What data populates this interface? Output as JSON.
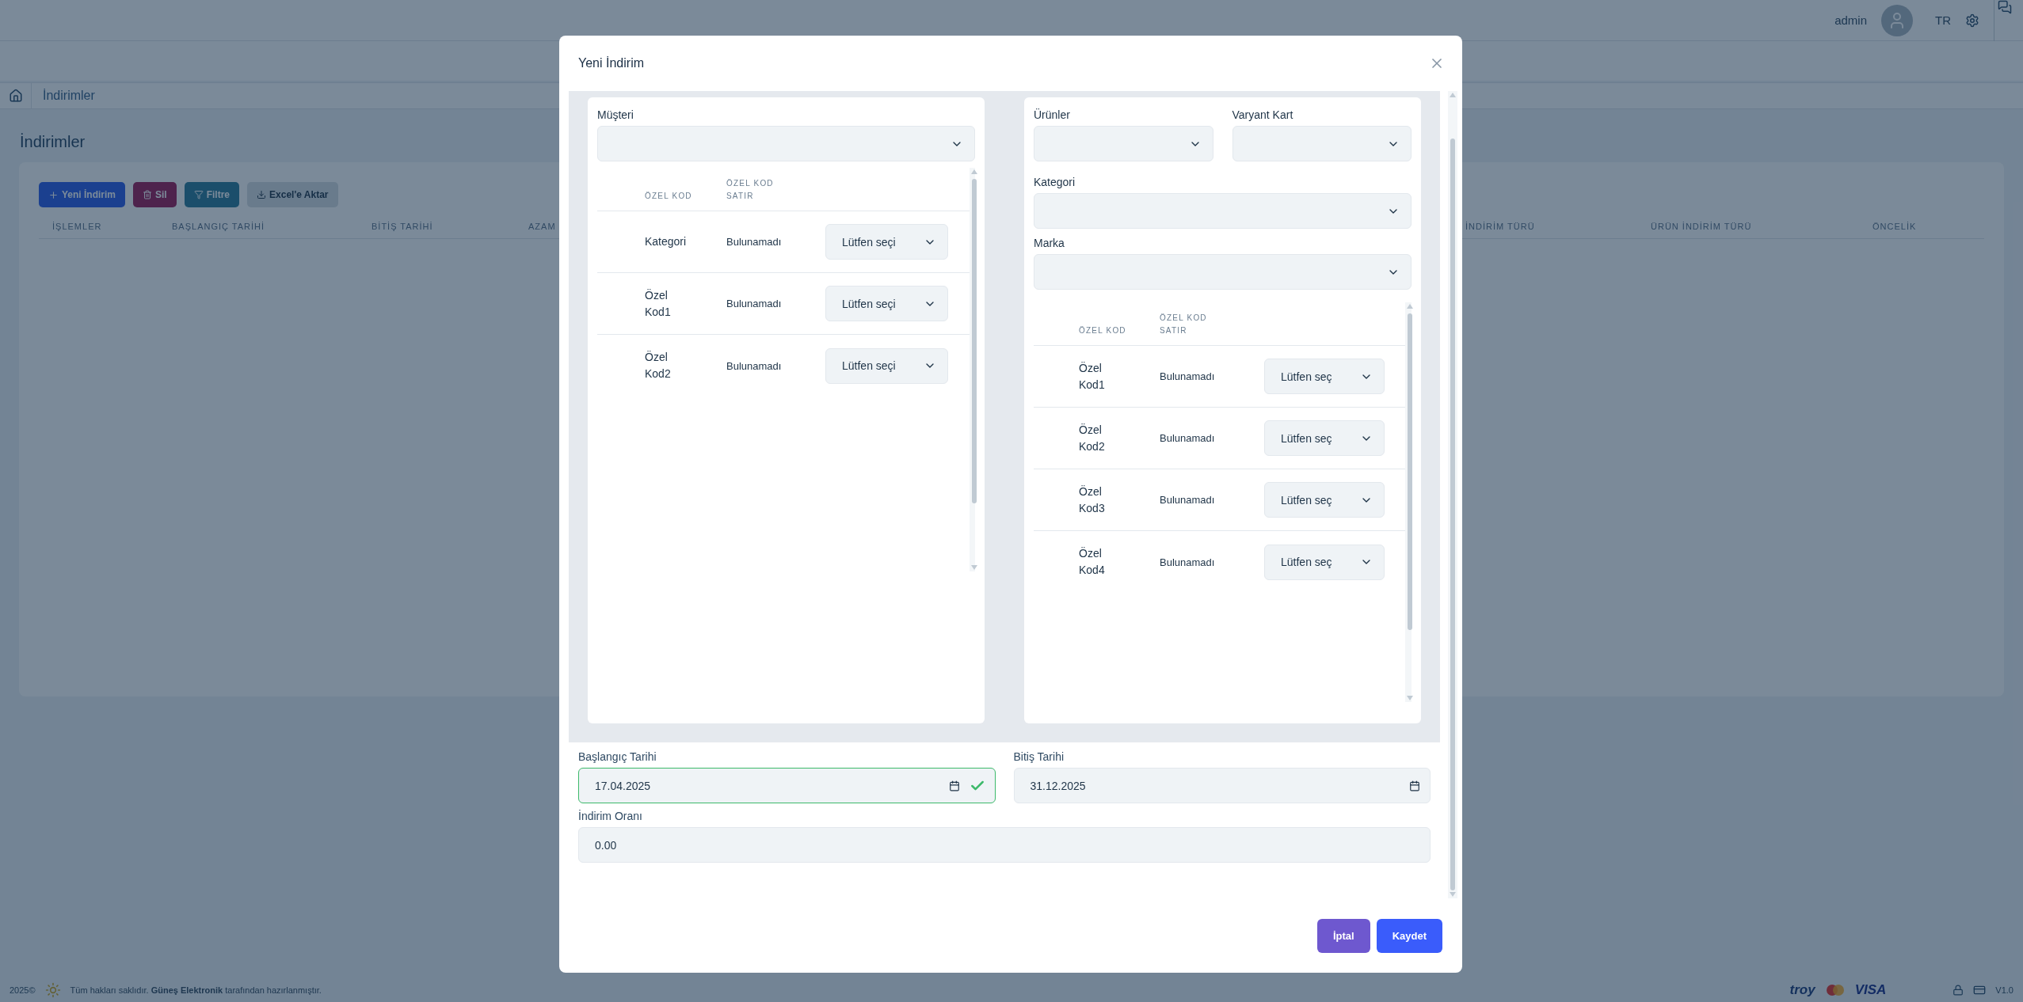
{
  "topbar": {
    "user": "admin",
    "language": "TR"
  },
  "breadcrumb": {
    "current": "İndirimler"
  },
  "page": {
    "title": "İndirimler",
    "buttons": [
      {
        "label": "Yeni İndirim",
        "kind": "add"
      },
      {
        "label": "Sil",
        "kind": "delete"
      },
      {
        "label": "Filtre",
        "kind": "filter"
      },
      {
        "label": "Excel'e Aktar",
        "kind": "export"
      }
    ],
    "columns": [
      "İŞLEMLER",
      "BAŞLANGIÇ TARİHİ",
      "BİTİŞ TARİHİ",
      "AZAM",
      "İNDİRİM TÜRÜ",
      "ÜRÜN İNDİRİM TÜRÜ",
      "ÖNCELİK"
    ]
  },
  "modal": {
    "title": "Yeni İndirim",
    "customer_panel": {
      "label": "Müşteri",
      "table": {
        "columns": [
          "ÖZEL KOD",
          "ÖZEL KOD SATIR"
        ],
        "rows": [
          {
            "code": "Kategori",
            "line": "Bulunamadı",
            "select": "Lütfen seçi"
          },
          {
            "code": "Özel Kod1",
            "line": "Bulunamadı",
            "select": "Lütfen seçi"
          },
          {
            "code": "Özel Kod2",
            "line": "Bulunamadı",
            "select": "Lütfen seçi"
          }
        ]
      }
    },
    "product_panel": {
      "fields": [
        {
          "label": "Ürünler"
        },
        {
          "label": "Varyant Kart"
        },
        {
          "label": "Kategori"
        },
        {
          "label": "Marka"
        }
      ],
      "table": {
        "columns": [
          "ÖZEL KOD",
          "ÖZEL KOD SATIR"
        ],
        "rows": [
          {
            "code": "Özel Kod1",
            "line": "Bulunamadı",
            "select": "Lütfen seç"
          },
          {
            "code": "Özel Kod2",
            "line": "Bulunamadı",
            "select": "Lütfen seç"
          },
          {
            "code": "Özel Kod3",
            "line": "Bulunamadı",
            "select": "Lütfen seç"
          },
          {
            "code": "Özel Kod4",
            "line": "Bulunamadı",
            "select": "Lütfen seç"
          }
        ]
      }
    },
    "dates": [
      {
        "label": "Başlangıç Tarihi",
        "value": "17.04.2025",
        "valid": true
      },
      {
        "label": "Bitiş Tarihi",
        "value": "31.12.2025",
        "valid": false
      }
    ],
    "rate": {
      "label": "İndirim Oranı",
      "value": "0.00"
    },
    "buttons": [
      {
        "label": "İptal",
        "kind": "cancel"
      },
      {
        "label": "Kaydet",
        "kind": "save"
      }
    ]
  },
  "footer": {
    "year": "2025©",
    "text": "Tüm hakları saklıdır. **Güneş Elektronik** tarafından hazırlanmıştır.",
    "brands": [
      "troy",
      "VISA"
    ],
    "version": "V1.0"
  }
}
